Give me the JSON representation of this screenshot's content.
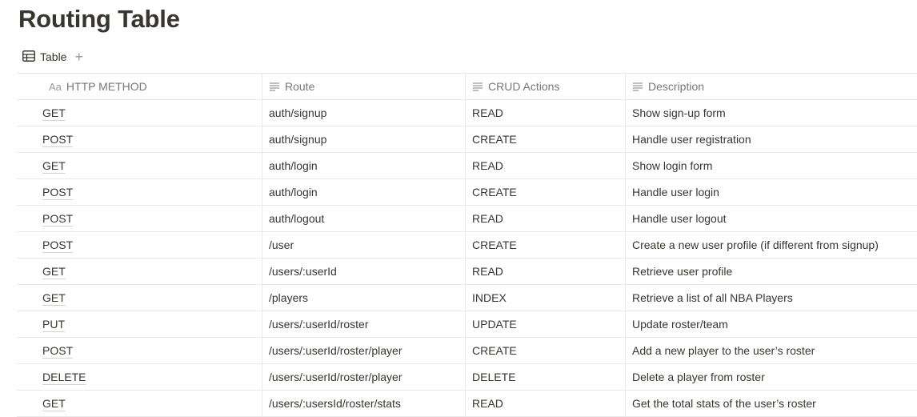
{
  "page": {
    "title": "Routing Table"
  },
  "views": {
    "tab_label": "Table",
    "add_label": "+"
  },
  "table": {
    "headers": [
      {
        "icon": "text-type-icon",
        "prefix": "Aa",
        "label": "HTTP METHOD"
      },
      {
        "icon": "text-lines-icon",
        "label": "Route"
      },
      {
        "icon": "text-lines-icon",
        "label": "CRUD Actions"
      },
      {
        "icon": "text-lines-icon",
        "label": "Description"
      }
    ],
    "rows": [
      {
        "method": "GET",
        "route": "auth/signup",
        "crud": "READ",
        "description": "Show sign-up form"
      },
      {
        "method": "POST",
        "route": "auth/signup",
        "crud": "CREATE",
        "description": "Handle user registration"
      },
      {
        "method": "GET",
        "route": "auth/login",
        "crud": "READ",
        "description": "Show login form"
      },
      {
        "method": "POST",
        "route": "auth/login",
        "crud": "CREATE",
        "description": "Handle user login"
      },
      {
        "method": "POST",
        "route": "auth/logout",
        "crud": "READ",
        "description": "Handle user logout"
      },
      {
        "method": "POST",
        "route": "/user",
        "crud": "CREATE",
        "description": "Create a new user profile (if different from signup)"
      },
      {
        "method": "GET",
        "route": "/users/:userId",
        "crud": "READ",
        "description": "Retrieve user profile"
      },
      {
        "method": "GET",
        "route": "/players",
        "crud": "INDEX",
        "description": "Retrieve a list of all NBA Players"
      },
      {
        "method": "PUT",
        "route": "/users/:userId/roster",
        "crud": "UPDATE",
        "description": "Update roster/team"
      },
      {
        "method": "POST",
        "route": "/users/:userId/roster/player",
        "crud": "CREATE",
        "description": "Add a new player to the user’s roster"
      },
      {
        "method": "DELETE",
        "route": "/users/:userId/roster/player",
        "crud": "DELETE",
        "description": "Delete a player from roster"
      },
      {
        "method": "GET",
        "route": "/users/:usersId/roster/stats",
        "crud": "READ",
        "description": "Get the total stats of the user’s roster"
      }
    ]
  }
}
